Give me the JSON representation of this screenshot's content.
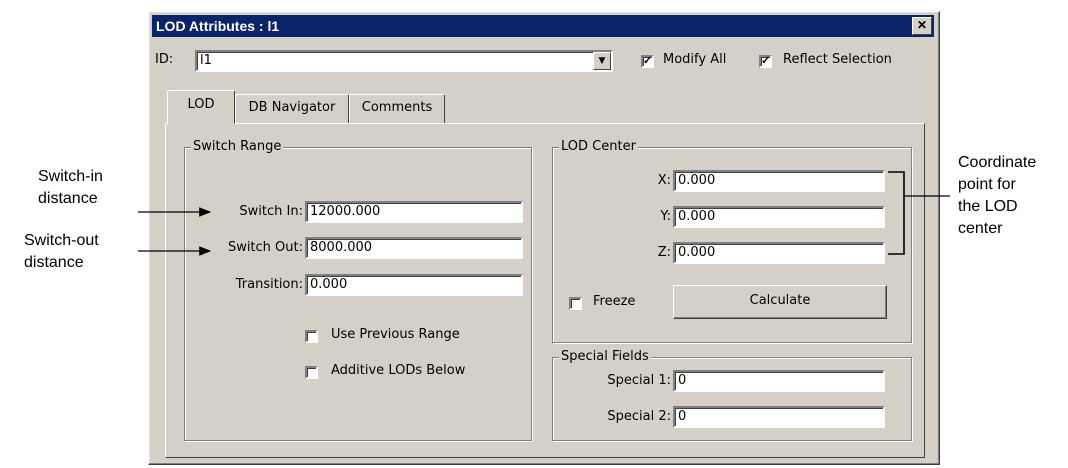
{
  "window": {
    "title": "LOD Attributes : l1",
    "close_glyph": "✕"
  },
  "id_row": {
    "label": "ID:",
    "value": "l1",
    "modify_all_label": "Modify All",
    "modify_all_checked": true,
    "reflect_label": "Reflect Selection",
    "reflect_checked": true
  },
  "tabs": [
    {
      "label": "LOD",
      "active": true
    },
    {
      "label": "DB Navigator"
    },
    {
      "label": "Comments"
    }
  ],
  "switch_range": {
    "title": "Switch Range",
    "switch_in_label": "Switch In:",
    "switch_in_value": "12000.000",
    "switch_out_label": "Switch Out:",
    "switch_out_value": "8000.000",
    "transition_label": "Transition:",
    "transition_value": "0.000",
    "use_previous_label": "Use Previous Range",
    "use_previous_checked": false,
    "additive_label": "Additive LODs Below",
    "additive_checked": false
  },
  "lod_center": {
    "title": "LOD Center",
    "x_label": "X:",
    "x_value": "0.000",
    "y_label": "Y:",
    "y_value": "0.000",
    "z_label": "Z:",
    "z_value": "0.000",
    "freeze_label": "Freeze",
    "freeze_checked": false,
    "calculate_label": "Calculate"
  },
  "special_fields": {
    "title": "Special Fields",
    "special1_label": "Special 1:",
    "special1_value": "0",
    "special2_label": "Special 2:",
    "special2_value": "0"
  },
  "annotations": {
    "switch_in": [
      "Switch-in",
      "distance"
    ],
    "switch_out": [
      "Switch-out",
      "distance"
    ],
    "coordinate": [
      "Coordinate",
      "point for",
      "the LOD",
      "center"
    ]
  }
}
